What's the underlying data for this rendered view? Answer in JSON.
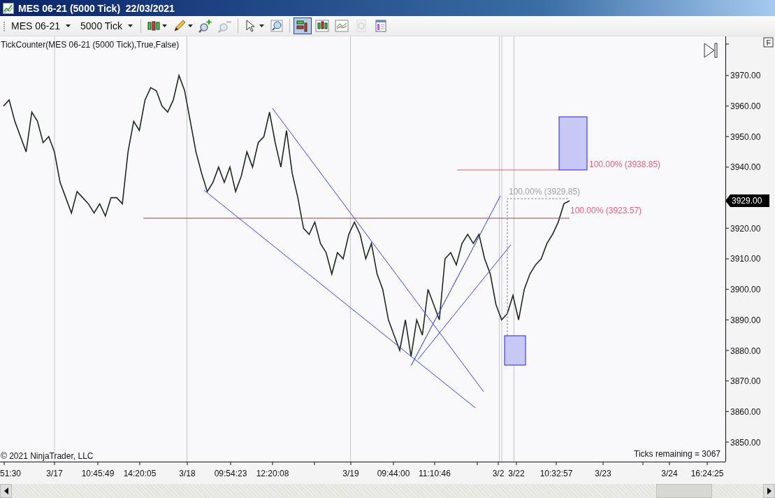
{
  "window": {
    "title": "MES 06-21 (5000 Tick)  22/03/2021"
  },
  "toolbar": {
    "instrument": "MES 06-21",
    "interval": "5000 Tick",
    "tools": [
      {
        "kind": "bar-style",
        "selected": false,
        "disabled": false
      },
      {
        "kind": "pencil",
        "selected": false,
        "disabled": false
      },
      {
        "kind": "zoom-in",
        "selected": false,
        "disabled": false
      },
      {
        "kind": "zoom-out",
        "selected": false,
        "disabled": true
      },
      {
        "kind": "pointer",
        "selected": false,
        "disabled": false
      },
      {
        "kind": "magnifier",
        "selected": false,
        "disabled": false
      },
      {
        "kind": "data-box",
        "selected": true,
        "disabled": false
      },
      {
        "kind": "chart-style",
        "selected": false,
        "disabled": false
      },
      {
        "kind": "indicators",
        "selected": false,
        "disabled": false
      },
      {
        "kind": "strategies",
        "selected": false,
        "disabled": true
      },
      {
        "kind": "properties",
        "selected": false,
        "disabled": false
      }
    ]
  },
  "chart": {
    "indicator_label": "TickCounter(MES  06-21 (5000  Tick),True,False)",
    "corner_button": "F",
    "copyright": "© 2021 NinjaTrader, LLC",
    "ticks_remaining": "Ticks remaining = 3067",
    "last_price": "3929.00",
    "drawing_labels": [
      {
        "text": "100.00% (3938.85)",
        "color": "#e06478"
      },
      {
        "text": "100.00% (3929.85)",
        "color": "#a0a0a8"
      },
      {
        "text": "100.00% (3923.57)",
        "color": "#e06478"
      }
    ],
    "time_axis": [
      "51:30",
      "3/17",
      "10:45:49",
      "14:20:05",
      "3/18",
      "09:54:23",
      "12:20:08",
      "3/19",
      "09:44:00",
      "11:10:46",
      "3/2",
      "3/22",
      "10:32:57",
      "3/23",
      "3/24",
      "16:24:25"
    ],
    "chart_data": {
      "type": "line",
      "ylim": [
        3843.6,
        3982.8
      ],
      "yticks": [
        {
          "value": 3850,
          "label": "3850.00"
        },
        {
          "value": 3860,
          "label": "3860.00"
        },
        {
          "value": 3870,
          "label": "3870.00"
        },
        {
          "value": 3880,
          "label": "3880.00"
        },
        {
          "value": 3890,
          "label": "3890.00"
        },
        {
          "value": 3900,
          "label": "3900.00"
        },
        {
          "value": 3910,
          "label": "3910.00"
        },
        {
          "value": 3920,
          "label": "3920.00"
        },
        {
          "value": 3940,
          "label": "3940.00"
        },
        {
          "value": 3950,
          "label": "3950.00"
        },
        {
          "value": 3960,
          "label": "3960.00"
        },
        {
          "value": 3970,
          "label": "3970.00"
        }
      ],
      "series": [
        {
          "color": "#1e2a1e",
          "values": [
            3960,
            3962,
            3955,
            3950,
            3945,
            3958,
            3955,
            3948,
            3950,
            3945,
            3935,
            3930,
            3925,
            3932,
            3930,
            3928,
            3925,
            3928,
            3924,
            3930,
            3930,
            3928,
            3945,
            3955,
            3952,
            3962,
            3966,
            3965,
            3960,
            3958,
            3962,
            3970,
            3965,
            3955,
            3945,
            3938,
            3932,
            3935,
            3940,
            3935,
            3940,
            3932,
            3937,
            3945,
            3940,
            3948,
            3950,
            3958,
            3948,
            3940,
            3952,
            3938,
            3930,
            3920,
            3918,
            3922,
            3915,
            3912,
            3905,
            3912,
            3910,
            3918,
            3922,
            3918,
            3910,
            3915,
            3905,
            3900,
            3890,
            3885,
            3880,
            3890,
            3878,
            3890,
            3885,
            3900,
            3895,
            3890,
            3910,
            3912,
            3908,
            3915,
            3918,
            3915,
            3918,
            3910,
            3905,
            3895,
            3890,
            3892,
            3898,
            3890,
            3900,
            3905,
            3908,
            3910,
            3915,
            3918,
            3922,
            3928,
            3929
          ]
        }
      ]
    }
  }
}
